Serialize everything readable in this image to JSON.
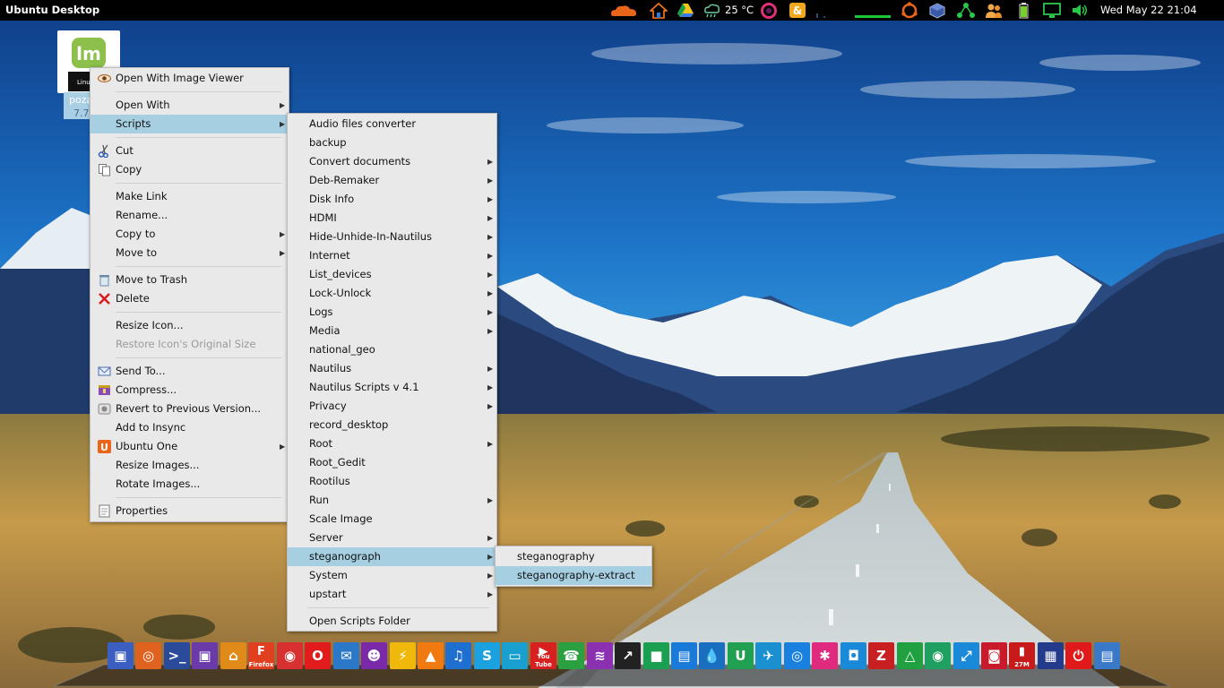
{
  "top_panel": {
    "title": "Ubuntu Desktop",
    "temperature": "25 °C",
    "clock": "Wed May 22 21:04",
    "tray_icons": [
      "cloud-icon",
      "home-icon",
      "drive-icon",
      "weather-icon",
      "ring-icon",
      "sync-icon",
      "cpu-graph-icon",
      "net-graph-icon",
      "ubuntu-icon",
      "box-icon",
      "network-icon",
      "users-icon",
      "battery-icon",
      "display-icon",
      "volume-icon"
    ]
  },
  "desktop_icon": {
    "name_fragment": "poza",
    "size_fragment": "7.7",
    "icon_caption": "Linux"
  },
  "context_menu": {
    "items": [
      {
        "label": "Open With Image Viewer",
        "icon": "eye-icon"
      },
      {
        "label": "Open With",
        "submenu": true
      },
      {
        "label": "Scripts",
        "submenu": true,
        "highlighted": true
      },
      {
        "label": "Cut",
        "icon": "scissors-icon"
      },
      {
        "label": "Copy",
        "icon": "copy-icon"
      },
      {
        "label": "Make Link"
      },
      {
        "label": "Rename..."
      },
      {
        "label": "Copy to",
        "submenu": true
      },
      {
        "label": "Move to",
        "submenu": true
      },
      {
        "label": "Move to Trash",
        "icon": "trash-icon"
      },
      {
        "label": "Delete",
        "icon": "delete-icon"
      },
      {
        "label": "Resize Icon..."
      },
      {
        "label": "Restore Icon's Original Size",
        "disabled": true
      },
      {
        "label": "Send To...",
        "icon": "mail-icon"
      },
      {
        "label": "Compress...",
        "icon": "archive-icon"
      },
      {
        "label": "Revert to Previous Version...",
        "icon": "revert-icon"
      },
      {
        "label": "Add to Insync"
      },
      {
        "label": "Ubuntu One",
        "icon": "ubuntu-one-icon",
        "submenu": true
      },
      {
        "label": "Resize Images..."
      },
      {
        "label": "Rotate Images..."
      },
      {
        "label": "Properties",
        "icon": "properties-icon"
      }
    ]
  },
  "scripts_menu": {
    "items": [
      {
        "label": "Audio files converter"
      },
      {
        "label": "backup"
      },
      {
        "label": "Convert documents",
        "submenu": true
      },
      {
        "label": "Deb-Remaker",
        "submenu": true
      },
      {
        "label": "Disk Info",
        "submenu": true
      },
      {
        "label": "HDMI",
        "submenu": true
      },
      {
        "label": "Hide-Unhide-In-Nautilus",
        "submenu": true
      },
      {
        "label": "Internet",
        "submenu": true
      },
      {
        "label": "List_devices",
        "submenu": true
      },
      {
        "label": "Lock-Unlock",
        "submenu": true
      },
      {
        "label": "Logs",
        "submenu": true
      },
      {
        "label": "Media",
        "submenu": true
      },
      {
        "label": "national_geo"
      },
      {
        "label": "Nautilus",
        "submenu": true
      },
      {
        "label": "Nautilus Scripts v 4.1",
        "submenu": true
      },
      {
        "label": "Privacy",
        "submenu": true
      },
      {
        "label": "record_desktop"
      },
      {
        "label": "Root",
        "submenu": true
      },
      {
        "label": "Root_Gedit"
      },
      {
        "label": "Rootilus"
      },
      {
        "label": "Run",
        "submenu": true
      },
      {
        "label": "Scale Image"
      },
      {
        "label": "Server",
        "submenu": true
      },
      {
        "label": "steganograph",
        "submenu": true,
        "highlighted": true
      },
      {
        "label": "System",
        "submenu": true
      },
      {
        "label": "upstart",
        "submenu": true
      },
      {
        "label": "Open Scripts Folder"
      }
    ]
  },
  "stegano_menu": {
    "items": [
      {
        "label": "steganography"
      },
      {
        "label": "steganography-extract",
        "highlighted": true
      }
    ]
  },
  "dock": {
    "items": [
      {
        "name": "mint-menu-icon",
        "color": "#3a5fc0",
        "glyph": "▣"
      },
      {
        "name": "ubuntu-icon",
        "color": "#e0621f",
        "glyph": "◎"
      },
      {
        "name": "terminal-icon",
        "color": "#2a4a9a",
        "glyph": ">_"
      },
      {
        "name": "desktop-icon",
        "color": "#6a3aa8",
        "glyph": "▣"
      },
      {
        "name": "home-icon",
        "color": "#e08a1a",
        "glyph": "⌂"
      },
      {
        "name": "firefox-icon",
        "color": "#e04020",
        "glyph": "F",
        "text": "Firefox"
      },
      {
        "name": "chrome-icon",
        "color": "#d83030",
        "glyph": "◉"
      },
      {
        "name": "opera-icon",
        "color": "#e21c1c",
        "glyph": "O"
      },
      {
        "name": "thunderbird-icon",
        "color": "#2b78c8",
        "glyph": "✉"
      },
      {
        "name": "pidgin-icon",
        "color": "#7a2aa8",
        "glyph": "☻"
      },
      {
        "name": "transmission-icon",
        "color": "#f0b80a",
        "glyph": "⚡"
      },
      {
        "name": "vlc-icon",
        "color": "#f07a10",
        "glyph": "▲"
      },
      {
        "name": "music-icon",
        "color": "#1e6fd0",
        "glyph": "♫"
      },
      {
        "name": "skype-icon",
        "color": "#1ba0e0",
        "glyph": "S"
      },
      {
        "name": "remote-desktop-icon",
        "color": "#1aa0d0",
        "glyph": "▭"
      },
      {
        "name": "youtube-icon",
        "color": "#d82020",
        "glyph": "▶",
        "text": "You Tube"
      },
      {
        "name": "chat-icon",
        "color": "#2aa040",
        "glyph": "☎"
      },
      {
        "name": "wifi-icon",
        "color": "#8a30b0",
        "glyph": "≋"
      },
      {
        "name": "launcher-icon",
        "color": "#222222",
        "glyph": "↗"
      },
      {
        "name": "video-icon",
        "color": "#1aa050",
        "glyph": "■"
      },
      {
        "name": "files-icon",
        "color": "#1a7ad8",
        "glyph": "▤"
      },
      {
        "name": "drop-icon",
        "color": "#1a6ec0",
        "glyph": "💧"
      },
      {
        "name": "mint-update-icon",
        "color": "#20a050",
        "glyph": "U"
      },
      {
        "name": "plane-icon",
        "color": "#1a90d0",
        "glyph": "✈"
      },
      {
        "name": "disk-icon",
        "color": "#1a80e0",
        "glyph": "◎"
      },
      {
        "name": "network-graph-icon",
        "color": "#e02a80",
        "glyph": "✱"
      },
      {
        "name": "screenshot-icon",
        "color": "#1a8ad8",
        "glyph": "◘"
      },
      {
        "name": "filezilla-icon",
        "color": "#c82020",
        "glyph": "Z"
      },
      {
        "name": "gdrive-icon",
        "color": "#20a040",
        "glyph": "△"
      },
      {
        "name": "chromium-icon",
        "color": "#20a060",
        "glyph": "◉"
      },
      {
        "name": "resize-icon",
        "color": "#1a8ad8",
        "glyph": "⤢"
      },
      {
        "name": "backup-icon",
        "color": "#c81a2a",
        "glyph": "◙"
      },
      {
        "name": "system-monitor-icon",
        "color": "#c81a1a",
        "glyph": "▮",
        "text": "27M"
      },
      {
        "name": "workspace-icon",
        "color": "#243a8a",
        "glyph": "▦"
      },
      {
        "name": "power-icon",
        "color": "#e01a1a",
        "glyph": "⏻"
      },
      {
        "name": "notes-icon",
        "color": "#3a78c8",
        "glyph": "▤"
      }
    ]
  }
}
